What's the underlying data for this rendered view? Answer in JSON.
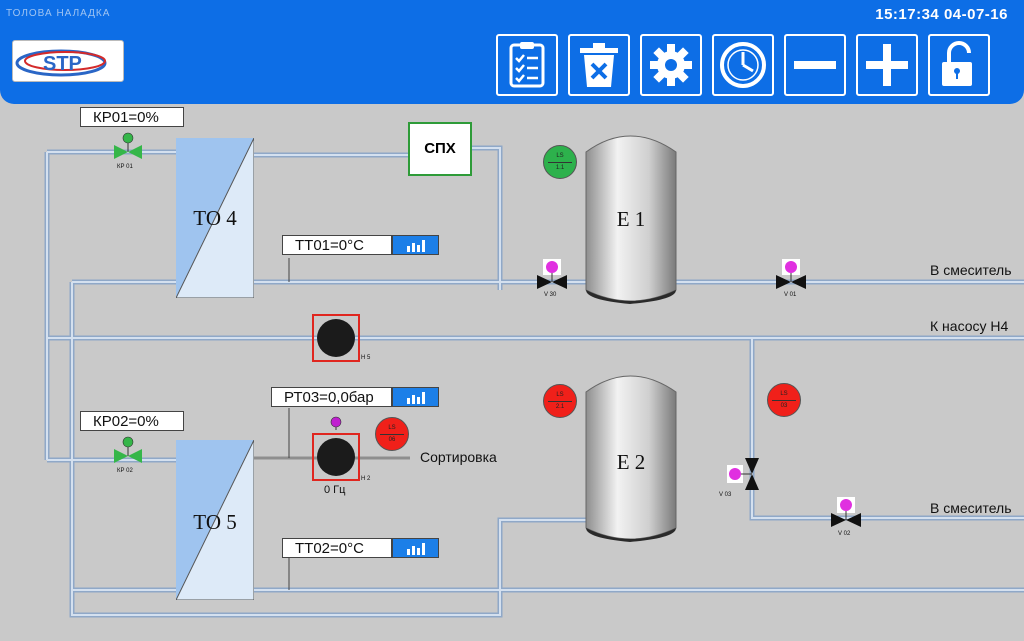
{
  "header": {
    "title": "ТОЛОВА НАЛАДКА",
    "datetime": "15:17:34 04-07-16",
    "toolbar": [
      {
        "name": "checklist-button",
        "icon": "checklist-icon"
      },
      {
        "name": "delete-button",
        "icon": "trash-icon"
      },
      {
        "name": "settings-button",
        "icon": "gear-icon"
      },
      {
        "name": "clock-button",
        "icon": "clock-icon"
      },
      {
        "name": "zoom-out-button",
        "icon": "minus-icon"
      },
      {
        "name": "zoom-in-button",
        "icon": "plus-icon"
      },
      {
        "name": "unlock-button",
        "icon": "unlock-icon"
      }
    ]
  },
  "exchangers": {
    "to4": "ТО 4",
    "to5": "ТО 5"
  },
  "tanks": {
    "e1": "Е 1",
    "e2": "Е 2"
  },
  "readouts": {
    "kp01": "КР01=0%",
    "kp02": "КР02=0%",
    "tt01": "ТТ01=0°С",
    "tt02": "ТТ02=0°С",
    "pt03": "РТ03=0,0бар"
  },
  "labels": {
    "sph": "СПХ",
    "to_mixer_1": "В смеситель",
    "to_mixer_2": "В смеситель",
    "to_pump_h4": "К насосу Н4",
    "sorting": "Сортировка",
    "pump_h2_freq": "0 Гц"
  },
  "tags": {
    "kp01": "КР 01",
    "kp02": "КР 02",
    "v30": "V 30",
    "v01": "V 01",
    "v02": "V 02",
    "v03": "V 03",
    "h5": "Н 5",
    "h2": "Н 2",
    "ls11_top": "LS",
    "ls11_bot": "1.1",
    "ls21_top": "LS",
    "ls21_bot": "2.1",
    "ls06_top": "LS",
    "ls06_bot": "06",
    "ls03_top": "LS",
    "ls03_bot": "03"
  },
  "colors": {
    "header": "#0d6ee6",
    "background": "#c9c9c9",
    "pipe": "#a9bfd9",
    "sensor_ok": "#2db14c",
    "sensor_alarm": "#f0201a",
    "valve_open": "#35b649",
    "valve_closed": "#111111"
  }
}
